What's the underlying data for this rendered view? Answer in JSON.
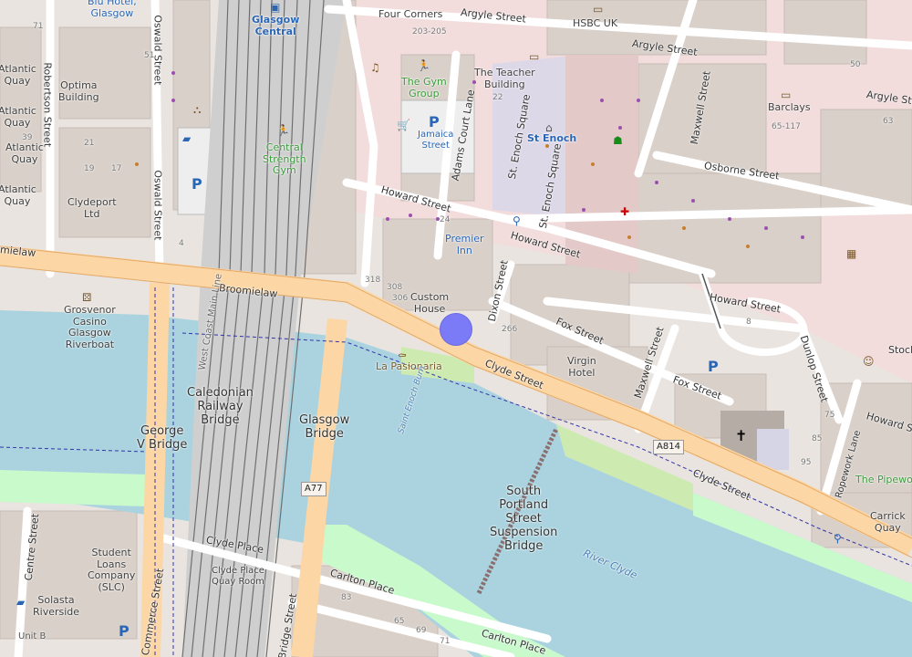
{
  "map": {
    "current_location_label": "",
    "colors": {
      "water": "#aad3df",
      "park": "#c8facc",
      "major_road": "#fcd6a4",
      "building": "#d9d0c9",
      "railway": "#8a8a8a",
      "location_dot": "#7b7bf7"
    }
  },
  "labels": {
    "blu_hotel": "Blu Hotel,\nGlasgow",
    "glasgow_central": "Glasgow\nCentral",
    "four_corners": "Four Corners",
    "argyle_street_top": "Argyle Street",
    "argyle_street_mid": "Argyle Street",
    "argyle_street_right": "Argyle Street",
    "hsbc": "HSBC UK",
    "oswald_street": "Oswald Street",
    "oswald_street_2": "Oswald Street",
    "robertson_street": "Robertson Street",
    "atlantic_quay_1": "Atlantic\nQuay",
    "atlantic_quay_2": "Atlantic\nQuay",
    "atlantic_quay_3": "Atlantic\nQuay",
    "atlantic_quay_4": "Atlantic\nQuay",
    "optima_building": "Optima\nBuilding",
    "clydeport": "Clydeport\nLtd",
    "gym_group": "The Gym\nGroup",
    "teacher_building": "The Teacher\nBuilding",
    "jamaica_street": "Jamaica\nStreet",
    "central_strength_gym": "Central\nStrength\nGym",
    "adams_court_lane": "Adams Court Lane",
    "st_enoch_square_1": "St. Enoch Square",
    "st_enoch_square_2": "St. Enoch Square",
    "st_enoch": "St Enoch",
    "maxwell_street_top": "Maxwell Street",
    "barclays": "Barclays",
    "osborne_street": "Osborne Street",
    "howard_street_1": "Howard Street",
    "howard_street_2": "Howard Street",
    "howard_street_3": "Howard Street",
    "howard_street_4": "Howard Street",
    "premier_inn": "Premier\nInn",
    "broomielaw": "Broomielaw",
    "broomielaw_left": "mielaw",
    "grosvenor_casino": "Grosvenor\nCasino\nGlasgow\nRiverboat",
    "west_coast_main_line": "West Coast Main Line",
    "custom_house": "Custom\nHouse",
    "dixon_street": "Dixon Street",
    "fox_street_1": "Fox Street",
    "fox_street_2": "Fox Street",
    "la_pasionaria": "La Pasionaria",
    "virgin_hotel": "Virgin\nHotel",
    "maxwell_street_bottom": "Maxwell Street",
    "dunlop_street": "Dunlop Street",
    "stock": "Stock",
    "caledonian_bridge": "Caledonian\nRailway\nBridge",
    "george_v_bridge": "George\nV Bridge",
    "glasgow_bridge": "Glasgow\nBridge",
    "st_enoch_burn": "Saint Enoch Burn",
    "clyde_street_1": "Clyde Street",
    "clyde_street_2": "Clyde Street",
    "south_portland": "South\nPortland\nStreet\nSuspension\nBridge",
    "river_clyde": "River Clyde",
    "ropework_lane": "Ropework Lane",
    "pipework": "The Pipework",
    "carrick_quay": "Carrick\nQuay",
    "clyde_place_1": "Clyde Place",
    "clyde_place_2": "Clyde Place\nQuay Room",
    "carlton_place_1": "Carlton Place",
    "carlton_place_2": "Carlton Place",
    "centre_street": "Centre Street",
    "student_loans": "Student\nLoans\nCompany\n(SLC)",
    "solasta": "Solasta\nRiverside",
    "unit_b": "Unit B",
    "commerce_street": "Commerce Street",
    "bridge_street": "Bridge Street",
    "a77": "A77",
    "a814": "A814"
  },
  "house_numbers": [
    "71",
    "51",
    "39",
    "21",
    "19",
    "17",
    "4",
    "203-205",
    "22",
    "24",
    "318",
    "308",
    "306",
    "266",
    "8",
    "65-117",
    "63",
    "50",
    "75",
    "85",
    "95",
    "83",
    "69",
    "71",
    "65",
    "15",
    "14",
    "16",
    "2"
  ]
}
